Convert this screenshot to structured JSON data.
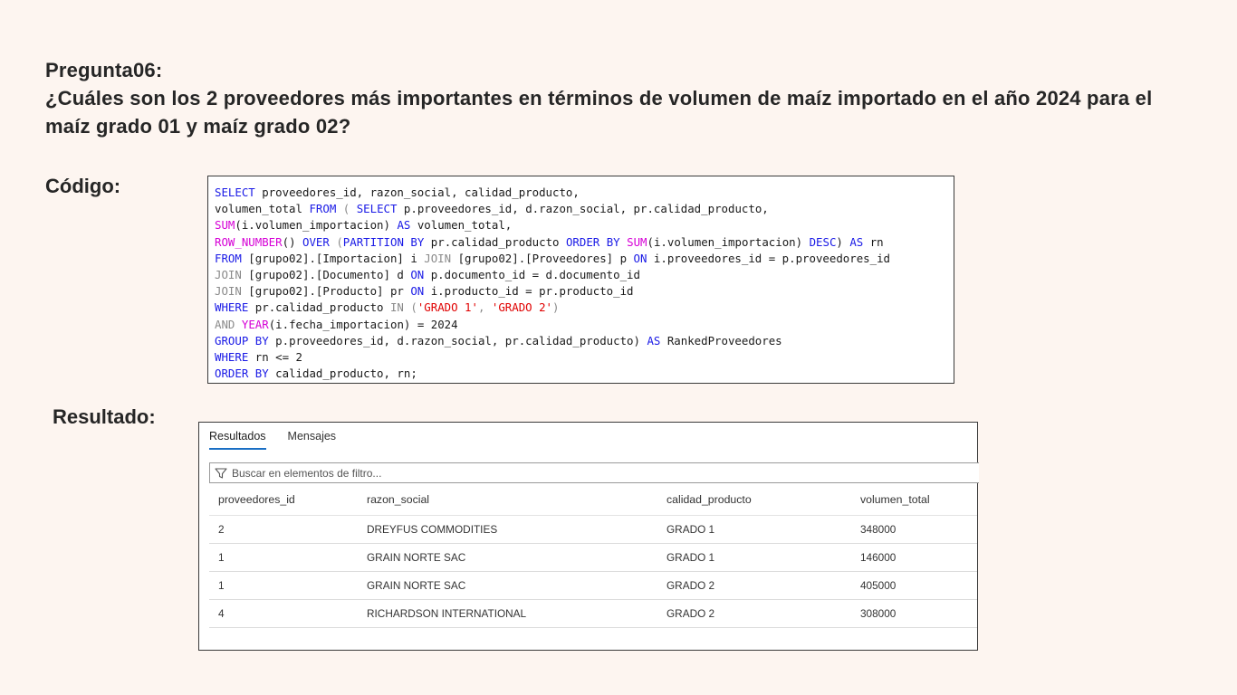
{
  "heading": {
    "line1": "Pregunta06:",
    "line2": "¿Cuáles son los 2 proveedores más importantes en términos de volumen de maíz importado en el año 2024 para el maíz grado 01 y maíz grado 02?"
  },
  "code_label": "Código:",
  "result_label": "Resultado:",
  "code": {
    "lines": [
      [
        {
          "t": "SELECT",
          "c": "kw"
        },
        {
          "t": " proveedores_id, razon_social, calidad_producto,",
          "c": ""
        }
      ],
      [
        {
          "t": "volumen_total ",
          "c": ""
        },
        {
          "t": "FROM",
          "c": "kw"
        },
        {
          "t": " ",
          "c": ""
        },
        {
          "t": "(",
          "c": "gray"
        },
        {
          "t": " ",
          "c": ""
        },
        {
          "t": "SELECT",
          "c": "kw"
        },
        {
          "t": " p.proveedores_id, d.razon_social, pr.calidad_producto,",
          "c": ""
        }
      ],
      [
        {
          "t": "SUM",
          "c": "fn"
        },
        {
          "t": "(i.volumen_importacion) ",
          "c": ""
        },
        {
          "t": "AS",
          "c": "kw"
        },
        {
          "t": " volumen_total,",
          "c": ""
        }
      ],
      [
        {
          "t": "ROW_NUMBER",
          "c": "fn"
        },
        {
          "t": "() ",
          "c": ""
        },
        {
          "t": "OVER",
          "c": "kw"
        },
        {
          "t": " ",
          "c": ""
        },
        {
          "t": "(",
          "c": "gray"
        },
        {
          "t": "PARTITION BY",
          "c": "kw"
        },
        {
          "t": " pr.calidad_producto ",
          "c": ""
        },
        {
          "t": "ORDER BY",
          "c": "kw"
        },
        {
          "t": " ",
          "c": ""
        },
        {
          "t": "SUM",
          "c": "fn"
        },
        {
          "t": "(i.volumen_importacion) ",
          "c": ""
        },
        {
          "t": "DESC",
          "c": "kw"
        },
        {
          "t": ") ",
          "c": ""
        },
        {
          "t": "AS",
          "c": "kw"
        },
        {
          "t": " rn",
          "c": ""
        }
      ],
      [
        {
          "t": "FROM",
          "c": "kw"
        },
        {
          "t": " [grupo02].[Importacion] i ",
          "c": ""
        },
        {
          "t": "JOIN",
          "c": "gray"
        },
        {
          "t": " [grupo02].[Proveedores] p ",
          "c": ""
        },
        {
          "t": "ON",
          "c": "kw"
        },
        {
          "t": " i.proveedores_id = p.proveedores_id",
          "c": ""
        }
      ],
      [
        {
          "t": "JOIN",
          "c": "gray"
        },
        {
          "t": " [grupo02].[Documento] d ",
          "c": ""
        },
        {
          "t": "ON",
          "c": "kw"
        },
        {
          "t": " p.documento_id = d.documento_id",
          "c": ""
        }
      ],
      [
        {
          "t": "JOIN",
          "c": "gray"
        },
        {
          "t": " [grupo02].[Producto] pr ",
          "c": ""
        },
        {
          "t": "ON",
          "c": "kw"
        },
        {
          "t": " i.producto_id = pr.producto_id",
          "c": ""
        }
      ],
      [
        {
          "t": "WHERE",
          "c": "kw"
        },
        {
          "t": " pr.calidad_producto ",
          "c": ""
        },
        {
          "t": "IN",
          "c": "gray"
        },
        {
          "t": " (",
          "c": "gray"
        },
        {
          "t": "'GRADO 1'",
          "c": "str"
        },
        {
          "t": ", ",
          "c": "gray"
        },
        {
          "t": "'GRADO 2'",
          "c": "str"
        },
        {
          "t": ")",
          "c": "gray"
        }
      ],
      [
        {
          "t": "AND",
          "c": "gray"
        },
        {
          "t": " ",
          "c": ""
        },
        {
          "t": "YEAR",
          "c": "fn"
        },
        {
          "t": "(i.fecha_importacion) = 2024",
          "c": ""
        }
      ],
      [
        {
          "t": "GROUP BY",
          "c": "kw"
        },
        {
          "t": " p.proveedores_id, d.razon_social, pr.calidad_producto) ",
          "c": ""
        },
        {
          "t": "AS",
          "c": "kw"
        },
        {
          "t": " RankedProveedores",
          "c": ""
        }
      ],
      [
        {
          "t": "WHERE",
          "c": "kw"
        },
        {
          "t": " rn <= 2",
          "c": ""
        }
      ],
      [
        {
          "t": "ORDER BY",
          "c": "kw"
        },
        {
          "t": " calidad_producto, rn;",
          "c": ""
        }
      ]
    ]
  },
  "results": {
    "tabs": [
      "Resultados",
      "Mensajes"
    ],
    "active_tab": 0,
    "filter_placeholder": "Buscar en elementos de filtro...",
    "columns": [
      "proveedores_id",
      "razon_social",
      "calidad_producto",
      "volumen_total"
    ],
    "rows": [
      [
        "2",
        "DREYFUS COMMODITIES",
        "GRADO 1",
        "348000"
      ],
      [
        "1",
        "GRAIN NORTE SAC",
        "GRADO 1",
        "146000"
      ],
      [
        "1",
        "GRAIN NORTE SAC",
        "GRADO 2",
        "405000"
      ],
      [
        "4",
        "RICHARDSON INTERNATIONAL",
        "GRADO 2",
        "308000"
      ]
    ]
  },
  "colors": {
    "background": "#fdf5f0",
    "keyword": "#1a1ae6",
    "function": "#d600d6",
    "string": "#e00000",
    "operator": "#8a8a8a",
    "active_tab_underline": "#1a6fc4"
  }
}
